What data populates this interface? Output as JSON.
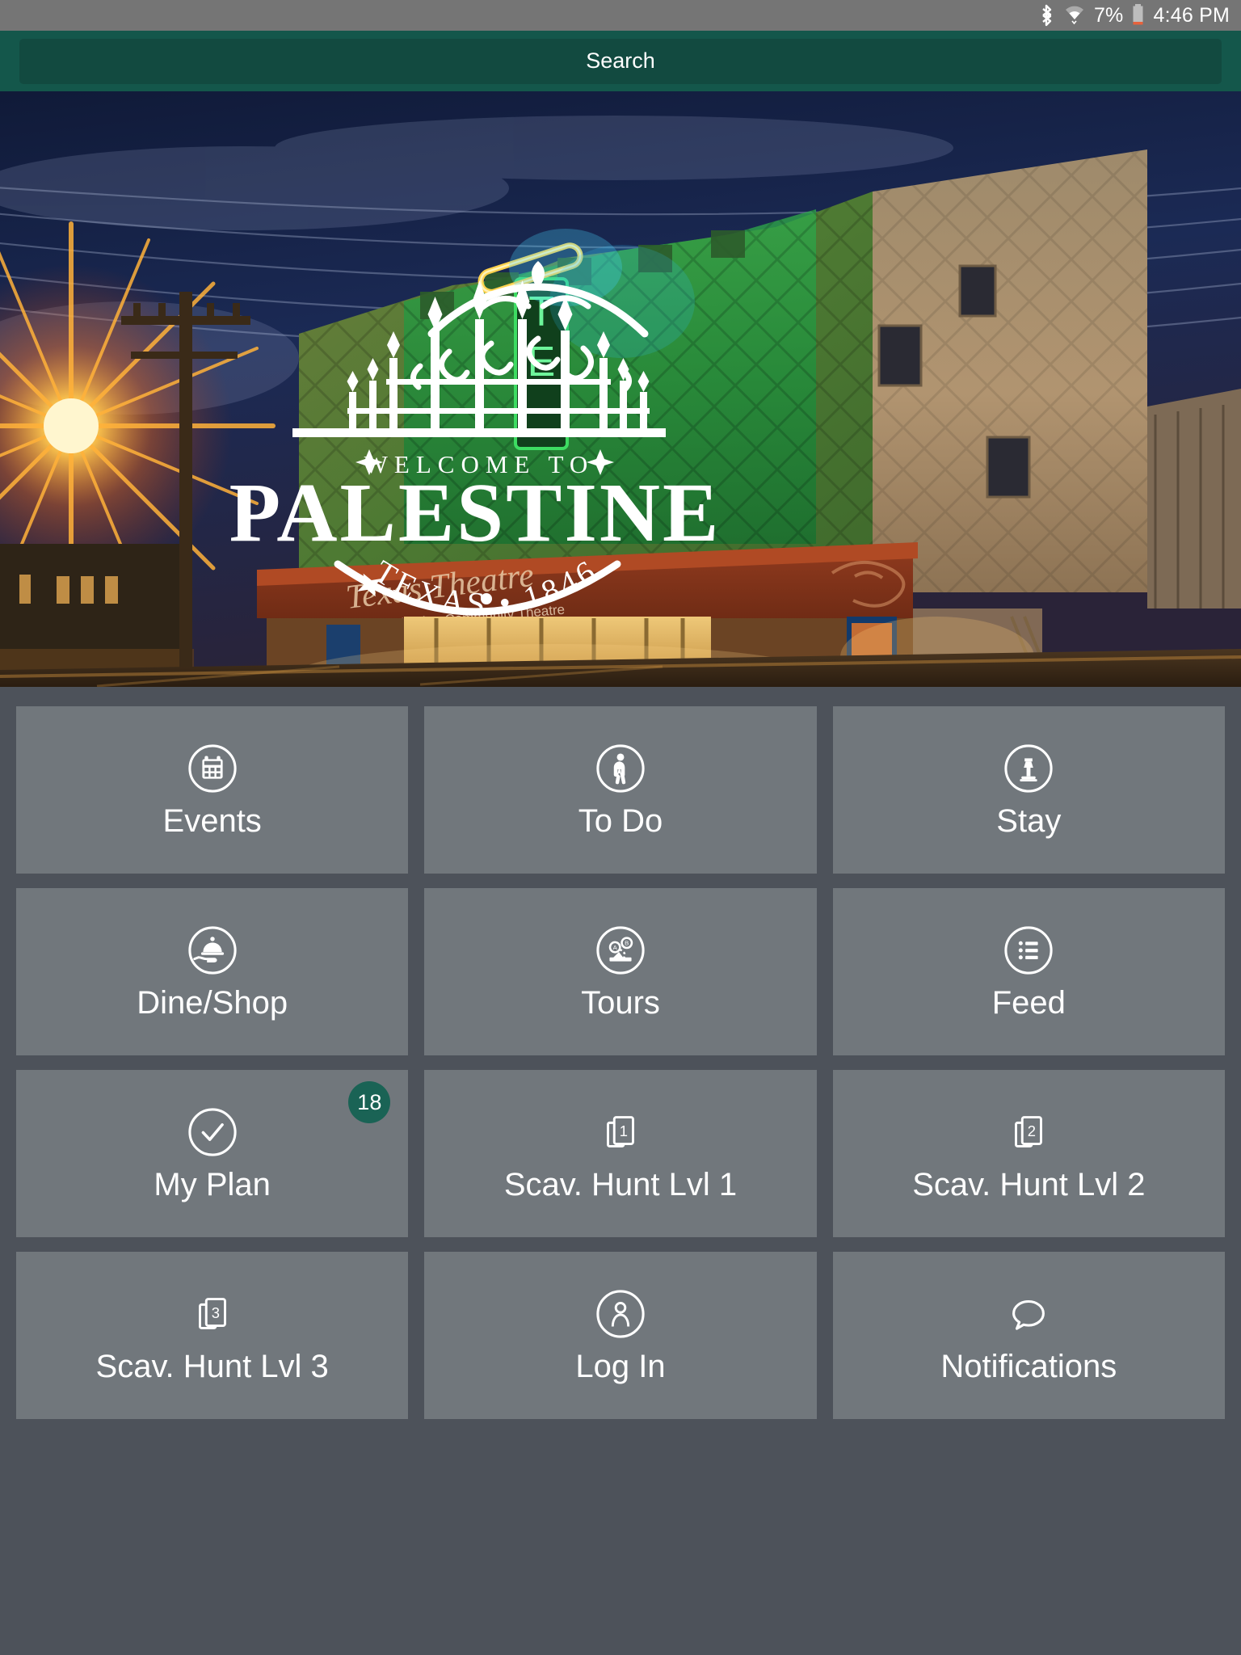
{
  "statusbar": {
    "bluetooth_icon": "bluetooth-icon",
    "wifi_icon": "wifi-icon",
    "battery_percent": "7%",
    "battery_icon": "battery-icon",
    "time": "4:46 PM",
    "background_color": "#757575"
  },
  "search": {
    "label": "Search",
    "bar_color": "#14574b",
    "field_color": "#124a40"
  },
  "hero": {
    "alt": "Texas Theatre at dusk with Welcome to Palestine Texas overlay",
    "logo": {
      "welcome_text": "WELCOME TO",
      "city": "PALESTINE",
      "state": "TEXAS",
      "separator": "•",
      "year": "1846"
    },
    "marquee": {
      "theatre_name": "Texas Theatre",
      "vertical_sign": "TE",
      "subtitle": "Home of Palestine Community Theatre"
    }
  },
  "grid": {
    "tile_color": "#71777c",
    "page_background": "#4d525a",
    "badge_color": "#1a6355",
    "tiles": [
      {
        "label": "Events",
        "icon": "calendar-icon",
        "badge": null
      },
      {
        "label": "To Do",
        "icon": "walking-person-icon",
        "badge": null
      },
      {
        "label": "Stay",
        "icon": "bed-lamp-icon",
        "badge": null
      },
      {
        "label": "Dine/Shop",
        "icon": "serving-tray-icon",
        "badge": null
      },
      {
        "label": "Tours",
        "icon": "map-route-icon",
        "badge": null
      },
      {
        "label": "Feed",
        "icon": "list-icon",
        "badge": null
      },
      {
        "label": "My Plan",
        "icon": "check-circle-icon",
        "badge": "18"
      },
      {
        "label": "Scav. Hunt Lvl 1",
        "icon": "cards-one-icon",
        "badge": null
      },
      {
        "label": "Scav. Hunt Lvl 2",
        "icon": "cards-two-icon",
        "badge": null
      },
      {
        "label": "Scav. Hunt Lvl 3",
        "icon": "cards-three-icon",
        "badge": null
      },
      {
        "label": "Log In",
        "icon": "person-icon",
        "badge": null
      },
      {
        "label": "Notifications",
        "icon": "speech-bubble-icon",
        "badge": null
      }
    ]
  }
}
